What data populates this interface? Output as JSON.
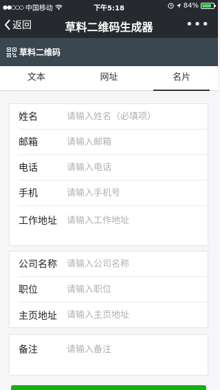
{
  "statusbar": {
    "carrier": "中国移动",
    "time": "下午5:18",
    "battery_text": "84%",
    "battery_level": 0.84,
    "signal_icon": "signal-dots-icon",
    "wifi_icon": "wifi-icon"
  },
  "navbar": {
    "back_label": "返回",
    "title": "草料二维码生成器",
    "more_label": "•••"
  },
  "brand": {
    "label": "草料二维码"
  },
  "tabs": [
    {
      "label": "文本"
    },
    {
      "label": "网址"
    },
    {
      "label": "名片",
      "active": true
    }
  ],
  "form": {
    "personal": [
      {
        "label": "姓名",
        "placeholder": "请输入姓名（必填项）"
      },
      {
        "label": "邮箱",
        "placeholder": "请输入邮箱"
      },
      {
        "label": "电话",
        "placeholder": "请输入电话"
      },
      {
        "label": "手机",
        "placeholder": "请输入手机号"
      },
      {
        "label": "工作地址",
        "placeholder": "请输入工作地址"
      }
    ],
    "company": [
      {
        "label": "公司名称",
        "placeholder": "请输入公司名称"
      },
      {
        "label": "职位",
        "placeholder": "请输入职位"
      },
      {
        "label": "主页地址",
        "placeholder": "请输入主页地址"
      }
    ],
    "note": {
      "label": "备注",
      "placeholder": "请输入备注"
    }
  },
  "colors": {
    "header_bg": "#26292e",
    "brand_bg": "#3a4650",
    "primary_green": "#1aad19"
  }
}
